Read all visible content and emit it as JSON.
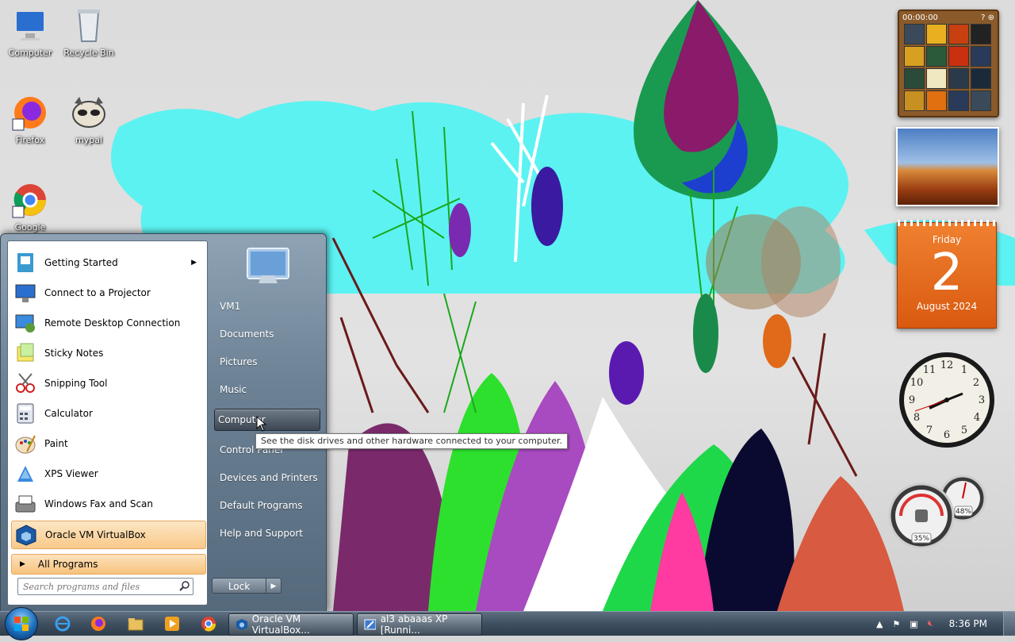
{
  "desktop_icons": [
    {
      "label": "Computer",
      "icon": "computer-icon"
    },
    {
      "label": "Recycle Bin",
      "icon": "recycle-bin-icon"
    },
    {
      "label": "Firefox",
      "icon": "firefox-icon"
    },
    {
      "label": "mypal",
      "icon": "mypal-icon"
    },
    {
      "label": "Google",
      "icon": "chrome-icon"
    }
  ],
  "gadgets": {
    "puzzle": {
      "timer": "00:00:00"
    },
    "calendar": {
      "weekday": "Friday",
      "day": "2",
      "month_year": "August 2024"
    },
    "cpu_meter": {
      "cpu": "35%",
      "memory": "48%"
    }
  },
  "start_menu": {
    "programs": [
      {
        "label": "Getting Started",
        "icon": "getting-started-icon",
        "has_submenu": true
      },
      {
        "label": "Connect to a Projector",
        "icon": "projector-icon"
      },
      {
        "label": "Remote Desktop Connection",
        "icon": "remote-desktop-icon"
      },
      {
        "label": "Sticky Notes",
        "icon": "sticky-notes-icon"
      },
      {
        "label": "Snipping Tool",
        "icon": "snipping-tool-icon"
      },
      {
        "label": "Calculator",
        "icon": "calculator-icon"
      },
      {
        "label": "Paint",
        "icon": "paint-icon"
      },
      {
        "label": "XPS Viewer",
        "icon": "xps-viewer-icon"
      },
      {
        "label": "Windows Fax and Scan",
        "icon": "fax-scan-icon"
      },
      {
        "label": "Oracle VM VirtualBox",
        "icon": "virtualbox-icon",
        "highlighted": true
      }
    ],
    "all_programs": "All Programs",
    "search_placeholder": "Search programs and files",
    "right_links": [
      {
        "label": "VM1"
      },
      {
        "label": "Documents"
      },
      {
        "label": "Pictures"
      },
      {
        "label": "Music"
      },
      {
        "label": "Computer",
        "highlighted": true
      },
      {
        "label": "Control Panel"
      },
      {
        "label": "Devices and Printers"
      },
      {
        "label": "Default Programs"
      },
      {
        "label": "Help and Support"
      }
    ],
    "lock_label": "Lock",
    "tooltip": "See the disk drives and other hardware connected to your computer."
  },
  "taskbar": {
    "pinned": [
      "internet-explorer-icon",
      "firefox-icon",
      "explorer-icon",
      "media-player-icon",
      "chrome-icon"
    ],
    "tasks": [
      {
        "label": "Oracle VM VirtualBox...",
        "icon": "virtualbox-icon"
      },
      {
        "label": "al3 abaaas XP [Runni...",
        "icon": "vm-window-icon"
      }
    ],
    "clock": "8:36 PM"
  },
  "colors": {
    "accent": "#f9c98a",
    "taskbar": "#3e4f60",
    "calendar": "#e8701e"
  }
}
